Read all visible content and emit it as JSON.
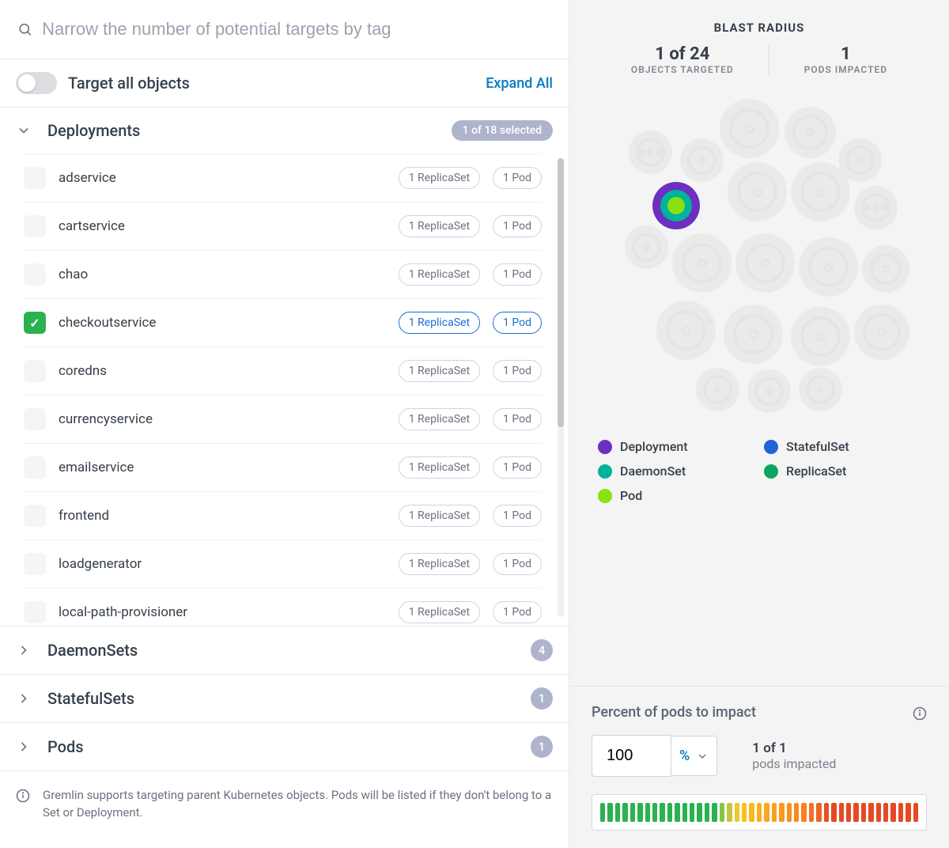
{
  "search": {
    "placeholder": "Narrow the number of potential targets by tag"
  },
  "targetAll": {
    "label": "Target all objects",
    "expandAll": "Expand All"
  },
  "sections": {
    "deployments": {
      "title": "Deployments",
      "badge": "1 of 18 selected"
    },
    "daemonsets": {
      "title": "DaemonSets",
      "count": "4"
    },
    "statefulsets": {
      "title": "StatefulSets",
      "count": "1"
    },
    "pods": {
      "title": "Pods",
      "count": "1"
    }
  },
  "items": [
    {
      "name": "adservice",
      "checked": false,
      "rs": "1 ReplicaSet",
      "pod": "1 Pod"
    },
    {
      "name": "cartservice",
      "checked": false,
      "rs": "1 ReplicaSet",
      "pod": "1 Pod"
    },
    {
      "name": "chao",
      "checked": false,
      "rs": "1 ReplicaSet",
      "pod": "1 Pod"
    },
    {
      "name": "checkoutservice",
      "checked": true,
      "rs": "1 ReplicaSet",
      "pod": "1 Pod"
    },
    {
      "name": "coredns",
      "checked": false,
      "rs": "1 ReplicaSet",
      "pod": "1 Pod"
    },
    {
      "name": "currencyservice",
      "checked": false,
      "rs": "1 ReplicaSet",
      "pod": "1 Pod"
    },
    {
      "name": "emailservice",
      "checked": false,
      "rs": "1 ReplicaSet",
      "pod": "1 Pod"
    },
    {
      "name": "frontend",
      "checked": false,
      "rs": "1 ReplicaSet",
      "pod": "1 Pod"
    },
    {
      "name": "loadgenerator",
      "checked": false,
      "rs": "1 ReplicaSet",
      "pod": "1 Pod"
    },
    {
      "name": "local-path-provisioner",
      "checked": false,
      "rs": "1 ReplicaSet",
      "pod": "1 Pod"
    }
  ],
  "infoFooter": "Gremlin supports targeting parent Kubernetes objects. Pods will be listed if they don't belong to a Set or Deployment.",
  "blast": {
    "header": "BLAST RADIUS",
    "objects": {
      "num": "1 of 24",
      "label": "OBJECTS TARGETED"
    },
    "pods": {
      "num": "1",
      "label": "PODS IMPACTED"
    }
  },
  "legend": [
    {
      "label": "Deployment",
      "color": "#6c2fc0"
    },
    {
      "label": "StatefulSet",
      "color": "#2262d8"
    },
    {
      "label": "DaemonSet",
      "color": "#00b39a"
    },
    {
      "label": "ReplicaSet",
      "color": "#0aa661"
    },
    {
      "label": "Pod",
      "color": "#8be010"
    }
  ],
  "impact": {
    "label": "Percent of pods to impact",
    "value": "100",
    "unit": "%",
    "resultNum": "1 of 1",
    "resultLabel": "pods impacted"
  },
  "gradientColors": [
    "#2ab250",
    "#2ab250",
    "#2ab250",
    "#2ab250",
    "#2ab250",
    "#2ab250",
    "#2ab250",
    "#2ab250",
    "#2ab250",
    "#2ab250",
    "#2ab250",
    "#2ab250",
    "#2ab250",
    "#2ab250",
    "#2ab250",
    "#2ab250",
    "#85c44a",
    "#c1c83e",
    "#e9c92e",
    "#f7c01f",
    "#f8b81f",
    "#f9b01f",
    "#f9a81f",
    "#faa020",
    "#fa9820",
    "#fa9020",
    "#fb8820",
    "#fb8021",
    "#f57026",
    "#ee6424",
    "#e85022",
    "#e54a24",
    "#e54a24",
    "#e54a24",
    "#e54a24",
    "#e54a24",
    "#e54a24",
    "#e54a24",
    "#e54a24",
    "#e54a24",
    "#e54a24",
    "#e54a24",
    "#e54a24"
  ]
}
